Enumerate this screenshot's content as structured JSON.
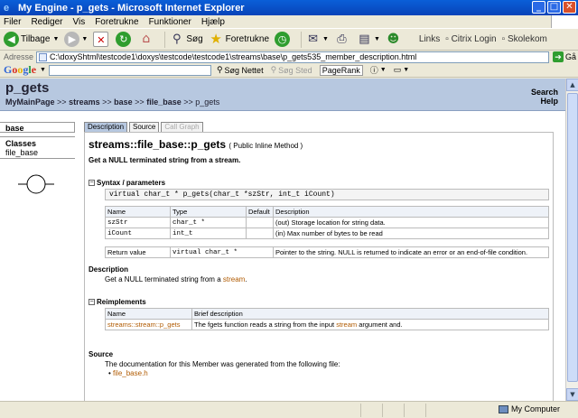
{
  "window": {
    "title": "My Engine - p_gets - Microsoft Internet Explorer",
    "minimize": "_",
    "maximize": "□",
    "close": "✕"
  },
  "menu": [
    "Filer",
    "Rediger",
    "Vis",
    "Foretrukne",
    "Funktioner",
    "Hjælp"
  ],
  "toolbar": {
    "back": "Tilbage",
    "search": "Søg",
    "favorites": "Foretrukne",
    "links_label": "Links",
    "link1": "Citrix Login",
    "link2": "Skolekom"
  },
  "address": {
    "label": "Adresse",
    "url": "C:\\doxyShtml\\testcode1\\doxys\\testcode\\testcode1\\streams\\base\\p_gets535_member_description.html",
    "go": "Gå"
  },
  "google": {
    "logo": [
      "G",
      "o",
      "o",
      "g",
      "l",
      "e"
    ],
    "search_web": "Søg Nettet",
    "search_site": "Søg Sted",
    "pagerank": "PageRank"
  },
  "header": {
    "title": "p_gets",
    "breadcrumb": [
      "MyMainPage",
      "streams",
      "base",
      "file_base",
      "p_gets"
    ],
    "separator": ">>",
    "search": "Search",
    "help": "Help"
  },
  "left": {
    "box": "base",
    "classes_label": "Classes",
    "class_item": "file_base"
  },
  "tabs": [
    "Description",
    "Source",
    "Call Graph"
  ],
  "member": {
    "title": "streams::file_base::p_gets",
    "subtitle": "( Public Inline Method )",
    "brief": "Get a NULL terminated string from a stream.",
    "syntax_label": "Syntax / parameters",
    "signature": "virtual char_t * p_gets(char_t *szStr, int_t iCount)",
    "params_header": [
      "Name",
      "Type",
      "Default",
      "Description"
    ],
    "params": [
      {
        "name": "szStr",
        "type": "char_t *",
        "default": "",
        "desc": "(out) Storage location for string data."
      },
      {
        "name": "iCount",
        "type": "int_t",
        "default": "",
        "desc": "(in) Max number of bytes to be read"
      }
    ],
    "return_label": "Return value",
    "return_type": "virtual char_t *",
    "return_desc": "Pointer to the string. NULL is returned to indicate an error or an end-of-file condition.",
    "description_label": "Description",
    "description_pre": "Get a NULL terminated string from a",
    "description_link": "stream",
    "description_post": ".",
    "reimpl_label": "Reimplements",
    "reimpl_header": [
      "Name",
      "Brief description"
    ],
    "reimpl_name": "streams::stream::p_gets",
    "reimpl_pre": "The fgets function reads a string from the input",
    "reimpl_link": "stream",
    "reimpl_post": "argument and.",
    "source_label": "Source",
    "source_text": "The documentation for this Member was generated from the following file:",
    "source_file": "file_base.h"
  },
  "status": {
    "zone": "My Computer"
  }
}
